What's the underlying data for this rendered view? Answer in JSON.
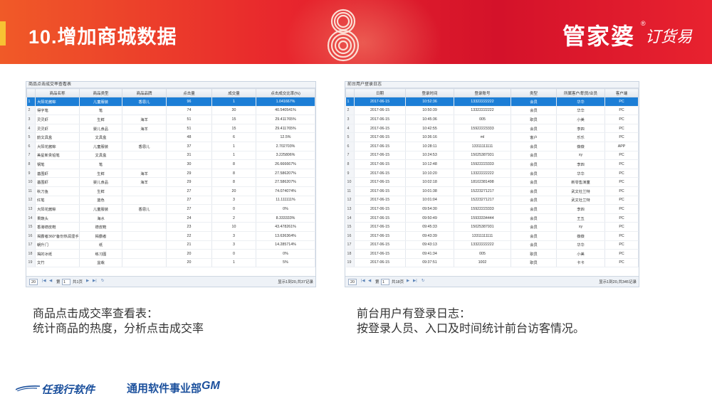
{
  "header": {
    "title": "10.增加商城数据",
    "brand": "管家婆",
    "brand_mark": "®",
    "brand_sub": "订货易"
  },
  "left_panel": {
    "title": "商品点击成交率查看表",
    "columns": [
      "",
      "商品名称",
      "商品类型",
      "商品品牌",
      "点击量",
      "成交量",
      "点击成交比率(%)"
    ],
    "rows": [
      [
        "1",
        "大阳花酱粽",
        "儿童服装",
        "香恩儿",
        "96",
        "1",
        "1.041667%"
      ],
      [
        "2",
        "得字笔",
        "笔",
        "",
        "74",
        "30",
        "40.540541%"
      ],
      [
        "3",
        "灵灵虾",
        "生鲜",
        "海羊",
        "51",
        "15",
        "29.411765%"
      ],
      [
        "4",
        "灵灵虾",
        "婴儿食品",
        "海羊",
        "51",
        "15",
        "29.411765%"
      ],
      [
        "5",
        "韵文具盒",
        "文具盒",
        "",
        "48",
        "6",
        "12.5%"
      ],
      [
        "6",
        "大阳花酱粽",
        "儿童服装",
        "香恩儿",
        "37",
        "1",
        "2.702703%"
      ],
      [
        "7",
        "美星新贵铅笔",
        "文具盒",
        "",
        "31",
        "1",
        "3.225806%"
      ],
      [
        "8",
        "钢笔",
        "笔",
        "",
        "30",
        "8",
        "26.666667%"
      ],
      [
        "9",
        "基围虾",
        "生鲜",
        "海羊",
        "29",
        "8",
        "27.586207%"
      ],
      [
        "10",
        "基围虾",
        "婴儿食品",
        "海羊",
        "29",
        "8",
        "27.586207%"
      ],
      [
        "11",
        "秋刀鱼",
        "生鲜",
        "",
        "27",
        "20",
        "74.074074%"
      ],
      [
        "12",
        "红笔",
        "蓝色",
        "",
        "27",
        "3",
        "11.111111%"
      ],
      [
        "13",
        "大阳花酱粽",
        "儿童服装",
        "香恩儿",
        "27",
        "0",
        "0%"
      ],
      [
        "14",
        "果蔬头",
        "海水",
        "",
        "24",
        "2",
        "8.333333%"
      ],
      [
        "15",
        "香港德皮鞋",
        "德皮鞋",
        "",
        "23",
        "10",
        "43.478261%"
      ],
      [
        "16",
        "揭霸者360°备份热润湿手霸180",
        "揭霸者",
        "",
        "22",
        "3",
        "13.636364%"
      ],
      [
        "17",
        "朝升门",
        "纸",
        "",
        "21",
        "3",
        "14.285714%"
      ],
      [
        "18",
        "揭的冰纸",
        "练习图",
        "",
        "20",
        "0",
        "0%"
      ],
      [
        "19",
        "文竹",
        "盆栽",
        "",
        "20",
        "1",
        "5%"
      ]
    ],
    "pager": {
      "page_size": "20",
      "page_label": "第",
      "page": "1",
      "total_label": "共1页",
      "info": "显示1到20,共37记录"
    }
  },
  "right_panel": {
    "title": "前台用户登录日志",
    "columns": [
      "",
      "日期",
      "登录时间",
      "登录账号",
      "类型",
      "所属客户/职员/业员",
      "客户端"
    ],
    "rows": [
      [
        "1",
        "2017-06-15",
        "10:52:36",
        "13322222222",
        "会员",
        "华华",
        "PC"
      ],
      [
        "2",
        "2017-06-15",
        "10:50:39",
        "13322222222",
        "会员",
        "华华",
        "PC"
      ],
      [
        "3",
        "2017-06-15",
        "10:45:36",
        "005",
        "职员",
        "小美",
        "PC"
      ],
      [
        "4",
        "2017-06-15",
        "10:42:55",
        "15922223333",
        "会员",
        "李四",
        "PC"
      ],
      [
        "5",
        "2017-06-15",
        "10:36:16",
        "ml",
        "客户",
        "乐乐",
        "PC"
      ],
      [
        "6",
        "2017-06-15",
        "10:28:11",
        "13311111111",
        "会员",
        "薇薇",
        "APP"
      ],
      [
        "7",
        "2017-06-15",
        "10:24:53",
        "15025387931",
        "会员",
        "xy",
        "PC"
      ],
      [
        "8",
        "2017-06-15",
        "10:12:48",
        "15922223333",
        "会员",
        "李四",
        "PC"
      ],
      [
        "9",
        "2017-06-15",
        "10:10:20",
        "13322222222",
        "会员",
        "华华",
        "PC"
      ],
      [
        "10",
        "2017-06-15",
        "10:02:18",
        "18102381498",
        "会员",
        "新零售演童",
        "PC"
      ],
      [
        "11",
        "2017-06-15",
        "10:01:38",
        "15223271217",
        "会员",
        "武文杜兰特",
        "PC"
      ],
      [
        "12",
        "2017-06-15",
        "10:01:04",
        "15223271217",
        "会员",
        "武文杜兰特",
        "PC"
      ],
      [
        "13",
        "2017-06-15",
        "09:54:30",
        "15922223333",
        "会员",
        "李四",
        "PC"
      ],
      [
        "14",
        "2017-06-15",
        "09:50:49",
        "15933334444",
        "会员",
        "王五",
        "PC"
      ],
      [
        "15",
        "2017-06-15",
        "09:45:33",
        "15025387931",
        "会员",
        "xy",
        "PC"
      ],
      [
        "16",
        "2017-06-15",
        "09:43:39",
        "13311111111",
        "会员",
        "薇薇",
        "PC"
      ],
      [
        "17",
        "2017-06-15",
        "09:43:13",
        "13322222222",
        "会员",
        "华华",
        "PC"
      ],
      [
        "18",
        "2017-06-15",
        "09:41:34",
        "005",
        "职员",
        "小美",
        "PC"
      ],
      [
        "19",
        "2017-06-15",
        "09:37:51",
        "1002",
        "职员",
        "卡卡",
        "PC"
      ]
    ],
    "pager": {
      "page_size": "20",
      "page_label": "第",
      "page": "1",
      "total_label": "共18页",
      "info": "显示1到20,共345记录"
    }
  },
  "captions": {
    "left_line1": "商品点击成交率查看表：",
    "left_line2": "统计商品的热度，分析点击成交率",
    "right_line1": "前台用户有登录日志：",
    "right_line2": "按登录人员、入口及时间统计前台访客情况。"
  },
  "footer": {
    "company": "任我行软件",
    "division": "通用软件事业部",
    "division_mark": "GM"
  },
  "colors": {
    "banner_red": "#e8262d",
    "selected_row": "#1c7ed6",
    "footer_blue": "#1a4f9c"
  }
}
